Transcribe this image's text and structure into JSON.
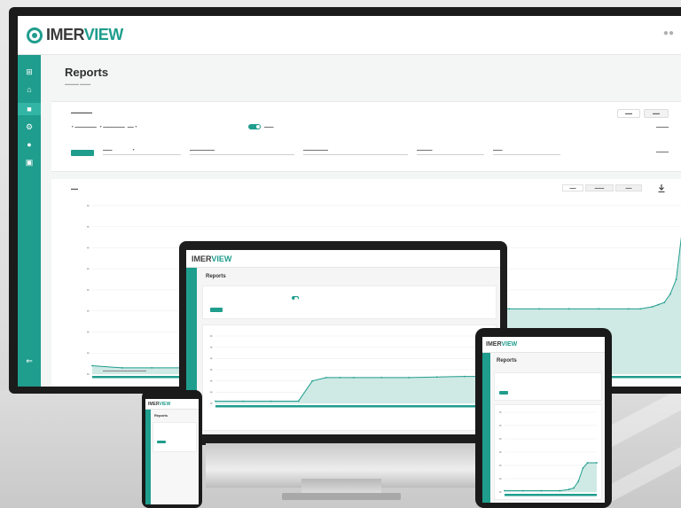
{
  "app": {
    "logo_prefix": "IMER",
    "logo_suffix": "VIEW"
  },
  "page": {
    "title": "Reports"
  },
  "filters": {
    "tabs": [
      "",
      ""
    ]
  },
  "colors": {
    "brand": "#1f9d8d",
    "sidebar": "#1f9d8d",
    "chart_fill": "#cfe9e5",
    "chart_line": "#1f9d8d"
  },
  "icons": {
    "sidebar": [
      "grid-icon",
      "home-icon",
      "reports-icon",
      "gear-icon",
      "globe-icon",
      "document-icon",
      "collapse-icon"
    ],
    "chart": "download-icon"
  },
  "chart_data": [
    {
      "type": "area",
      "device": "desktop",
      "x": [
        0,
        5,
        10,
        15,
        20,
        25,
        30,
        35,
        40,
        45,
        50,
        55,
        60,
        65,
        70,
        75,
        80,
        85,
        90,
        92,
        94,
        95,
        96,
        97,
        98,
        99,
        100
      ],
      "y": [
        0.4,
        0.3,
        0.3,
        0.3,
        0.3,
        0.3,
        0.3,
        0.3,
        0.3,
        0.3,
        3.1,
        3.1,
        3.1,
        3.1,
        3.1,
        3.1,
        3.1,
        3.1,
        3.1,
        3.1,
        3.2,
        3.3,
        3.4,
        3.8,
        4.5,
        6.8,
        7.3
      ],
      "ylim": [
        0,
        8
      ],
      "grid": true,
      "title": "",
      "xlabel": "",
      "ylabel": ""
    },
    {
      "type": "area",
      "device": "laptop",
      "x": [
        0,
        10,
        20,
        30,
        35,
        40,
        45,
        50,
        60,
        70,
        80,
        90,
        100
      ],
      "y": [
        0.2,
        0.2,
        0.2,
        0.2,
        2.0,
        2.3,
        2.3,
        2.3,
        2.3,
        2.3,
        2.35,
        2.4,
        2.4
      ],
      "ylim": [
        0,
        6
      ],
      "grid": true,
      "title": "",
      "xlabel": "",
      "ylabel": ""
    },
    {
      "type": "area",
      "device": "tablet",
      "x": [
        0,
        20,
        40,
        60,
        70,
        75,
        80,
        85,
        90,
        100
      ],
      "y": [
        0.1,
        0.1,
        0.1,
        0.1,
        0.2,
        0.3,
        0.8,
        1.8,
        2.2,
        2.2
      ],
      "ylim": [
        0,
        6
      ],
      "grid": true,
      "title": "",
      "xlabel": "",
      "ylabel": ""
    }
  ]
}
